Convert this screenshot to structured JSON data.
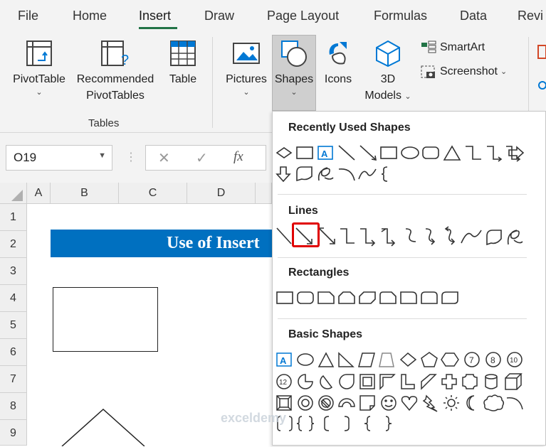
{
  "tabs": [
    "File",
    "Home",
    "Insert",
    "Draw",
    "Page Layout",
    "Formulas",
    "Data",
    "Revi"
  ],
  "ribbon": {
    "pivottable": "PivotTable",
    "recommended": "Recommended",
    "pivottables": "PivotTables",
    "table": "Table",
    "tables_group": "Tables",
    "pictures": "Pictures",
    "shapes": "Shapes",
    "icons": "Icons",
    "models_3d": "3D",
    "models": "Models",
    "smartart": "SmartArt",
    "screenshot": "Screenshot"
  },
  "formula_bar": {
    "name_box": "O19",
    "cancel": "✕",
    "enter": "✓",
    "fx": "fx"
  },
  "columns": [
    "A",
    "B",
    "C",
    "D"
  ],
  "rows": [
    "1",
    "2",
    "3",
    "4",
    "5",
    "6",
    "7",
    "8",
    "9"
  ],
  "sheet": {
    "banner": "Use of Insert"
  },
  "dropdown": {
    "recent": "Recently Used Shapes",
    "lines": "Lines",
    "rectangles": "Rectangles",
    "basic": "Basic Shapes"
  },
  "watermark": "exceldemy",
  "colors": {
    "accent": "#217346",
    "banner": "#0070c0",
    "highlight": "#e00000"
  }
}
